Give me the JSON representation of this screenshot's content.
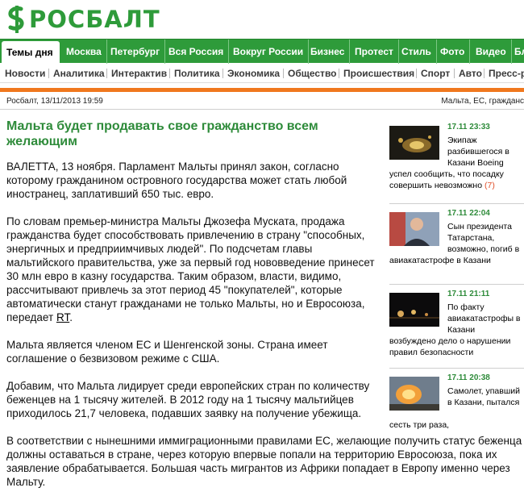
{
  "logo": {
    "text": "РОСБАЛТ",
    "icon": "rosbalt-dollar-logo-icon",
    "color": "#2e9b3a"
  },
  "topnav": {
    "tabs": [
      "Темы дня",
      "Москва",
      "Петербург",
      "Вся Россия",
      "Вокруг России",
      "Бизнес",
      "Протест",
      "Стиль",
      "Фото",
      "Видео",
      "Бл"
    ],
    "active_index": 0
  },
  "subnav": {
    "items": [
      "Новости",
      "Аналитика",
      "Интерактив",
      "Политика",
      "Экономика",
      "Общество",
      "Происшествия",
      "Спорт",
      "Авто",
      "Пресс-р"
    ]
  },
  "meta": {
    "source_date": "Росбалт, 13/11/2013 19:59",
    "tags": "Мальта, ЕС, гражданс"
  },
  "article": {
    "headline": "Мальта будет продавать свое гражданство всем желающим",
    "paragraphs": [
      "ВАЛЕТТА, 13 ноября. Парламент Мальты принял закон, согласно которому гражданином островного государства может стать любой иностранец, заплативший 650 тыс. евро.",
      "По словам премьер-министра Мальты Джозефа Муската, продажа гражданства будет способствовать привлечению в страну \"способных, энергичных и предприимчивых людей\". По подсчетам главы мальтийского правительства, уже за первый год нововведение принесет 30 млн евро в казну государства. Таким образом, власти, видимо, рассчитывают привлечь за этот период 45 \"покупателей\", которые автоматически станут гражданами не только Мальты, но и Евросоюза, передает",
      "Мальта является членом ЕС и Шенгенской зоны. Страна имеет соглашение о безвизовом режиме с США.",
      "Добавим, что Мальта лидирует среди европейских стран по количеству беженцев на 1 тысячу жителей. В 2012 году на 1 тысячу мальтийцев приходилось 21,7 человека, подавших заявку на получение убежища.",
      "В соответствии с нынешними иммиграционными правилами ЕС, желающие получить статус беженца должны оставаться в стране, через которую впервые попали на территорию Евросоюза, пока их заявление обрабатывается. Большая часть мигрантов из Африки попадает в Европу именно через Мальту."
    ],
    "source_link": "RT",
    "source_suffix": "."
  },
  "sidebar": {
    "news": [
      {
        "time": "17.11 23:33",
        "title_head": "Экипаж разбившегося в Казани Boeing",
        "title_tail": "успел сообщить, что посадку совершить невозможно",
        "count": "(7)",
        "thumb": "crash-night-photo"
      },
      {
        "time": "17.11 22:04",
        "title_head": "Сын президента Татарстана, возможно, погиб в",
        "title_tail": "авиакатастрофе в Казани",
        "count": "",
        "thumb": "president-portrait-photo"
      },
      {
        "time": "17.11 21:11",
        "title_head": "По факту авиакатастрофы в Казани",
        "title_tail": "возбуждено дело о нарушении правил безопасности",
        "count": "",
        "thumb": "airport-night-photo"
      },
      {
        "time": "17.11 20:38",
        "title_head": "Самолет, упавший в Казани, пытался",
        "title_tail": "сесть три раза,",
        "count": "",
        "thumb": "fire-explosion-photo"
      }
    ]
  }
}
